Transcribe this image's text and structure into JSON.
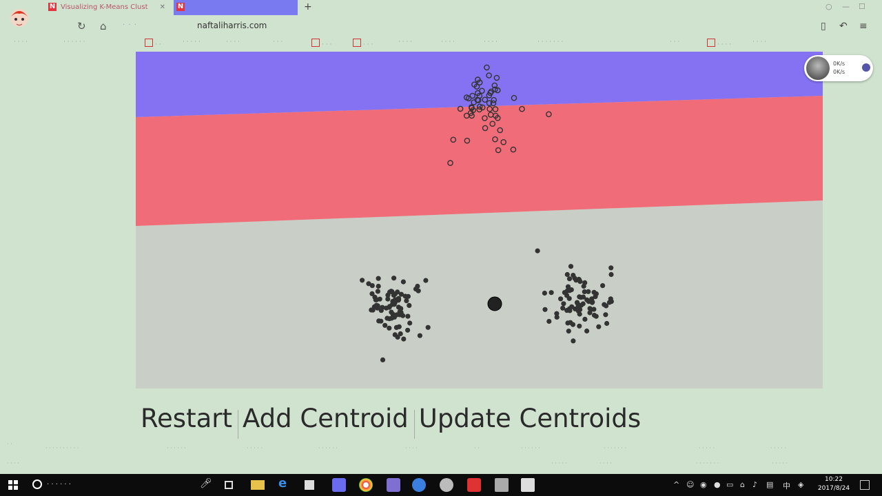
{
  "browser": {
    "tabs": [
      {
        "favicon": "N",
        "title": "Visualizing K-Means Clust"
      },
      {
        "favicon": "N",
        "title": ""
      }
    ],
    "url": "naftaliharris.com",
    "colors": {
      "chrome_bg": "#cfe3cf",
      "active_tab": "#7a7af0"
    }
  },
  "viz": {
    "colors": {
      "region_blue": "#8472f2",
      "region_red": "#f06c79",
      "region_gray": "#c9cfc6",
      "point_fill": "#333333"
    }
  },
  "controls": {
    "restart": "Restart",
    "add_centroid": "Add Centroid",
    "update_centroids": "Update Centroids"
  },
  "widget": {
    "line1": "0K/s",
    "line2": "0K/s"
  },
  "taskbar": {
    "time": "10:22",
    "date": "2017/8/24",
    "ime": "中"
  }
}
